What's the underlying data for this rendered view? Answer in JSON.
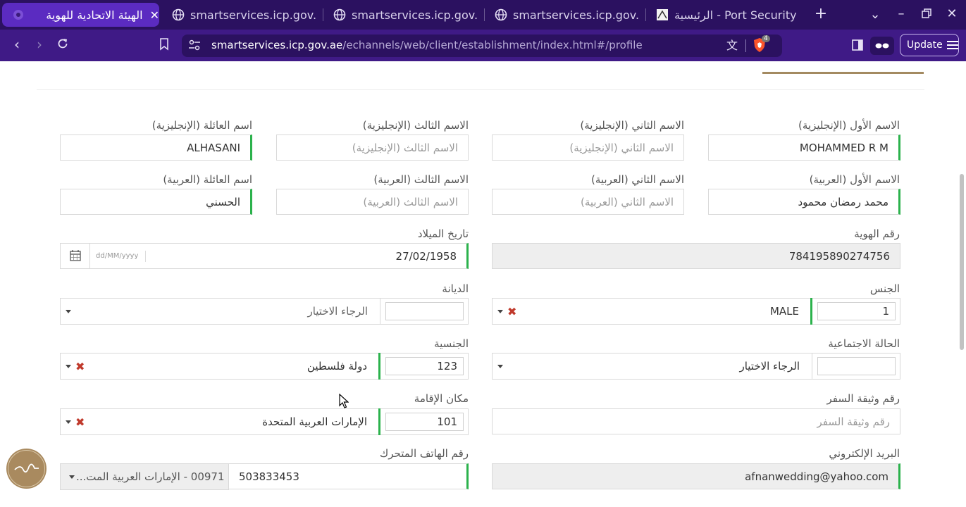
{
  "browser": {
    "tabs": [
      {
        "title": "الهيئة الاتحادية للهوية",
        "active": true
      },
      {
        "title": "smartservices.icp.gov.ae"
      },
      {
        "title": "smartservices.icp.gov.ae"
      },
      {
        "title": "smartservices.icp.gov.ae"
      },
      {
        "title": "Port Security - الرئيسية"
      }
    ],
    "url_host": "smartservices.icp.gov.ae",
    "url_path": "/echannels/web/client/establishment/index.html#/profile",
    "shields_count": "4",
    "update_label": "Update",
    "accent": "#2b1160"
  },
  "form": {
    "first_name_en": {
      "label": "الاسم الأول (الإنجليزية)",
      "value": "MOHAMMED R M"
    },
    "second_name_en": {
      "label": "الاسم الثاني (الإنجليزية)",
      "placeholder": "الاسم الثاني (الإنجليزية)"
    },
    "third_name_en": {
      "label": "الاسم الثالث (الإنجليزية)",
      "placeholder": "الاسم الثالث (الإنجليزية)"
    },
    "family_name_en": {
      "label": "اسم العائلة (الإنجليزية)",
      "value": "ALHASANI"
    },
    "first_name_ar": {
      "label": "الاسم الأول (العربية)",
      "value": "محمد رمضان محمود"
    },
    "second_name_ar": {
      "label": "الاسم الثاني (العربية)",
      "placeholder": "الاسم الثاني (العربية)"
    },
    "third_name_ar": {
      "label": "الاسم الثالث (العربية)",
      "placeholder": "الاسم الثالث (العربية)"
    },
    "family_name_ar": {
      "label": "اسم العائلة (العربية)",
      "value": "الحسني"
    },
    "id_number": {
      "label": "رقم الهوية",
      "value": "784195890274756"
    },
    "birth_date": {
      "label": "تاريخ الميلاد",
      "value": "27/02/1958",
      "format_hint": "dd/MM/yyyy"
    },
    "gender": {
      "label": "الجنس",
      "code": "1",
      "value": "MALE"
    },
    "religion": {
      "label": "الديانة",
      "code": "",
      "placeholder": "الرجاء الاختيار"
    },
    "marital_status": {
      "label": "الحالة الاجتماعية",
      "code": "",
      "placeholder": "الرجاء الاختيار"
    },
    "nationality": {
      "label": "الجنسية",
      "code": "123",
      "value": "دولة فلسطين"
    },
    "travel_doc": {
      "label": "رقم وثيقة السفر",
      "placeholder": "رقم وثيقة السفر"
    },
    "residence": {
      "label": "مكان الإقامة",
      "code": "101",
      "value": "الإمارات العربية المتحدة"
    },
    "email": {
      "label": "البريد الإلكتروني",
      "value": "afnanwedding@yahoo.com"
    },
    "mobile": {
      "label": "رقم الهاتف المتحرك",
      "country": "00971 - الإمارات العربية المت...",
      "value": "503833453"
    }
  },
  "colors": {
    "valid": "#2bb24c",
    "brand_gold": "#a38a61",
    "clear_x": "#c0392b"
  }
}
